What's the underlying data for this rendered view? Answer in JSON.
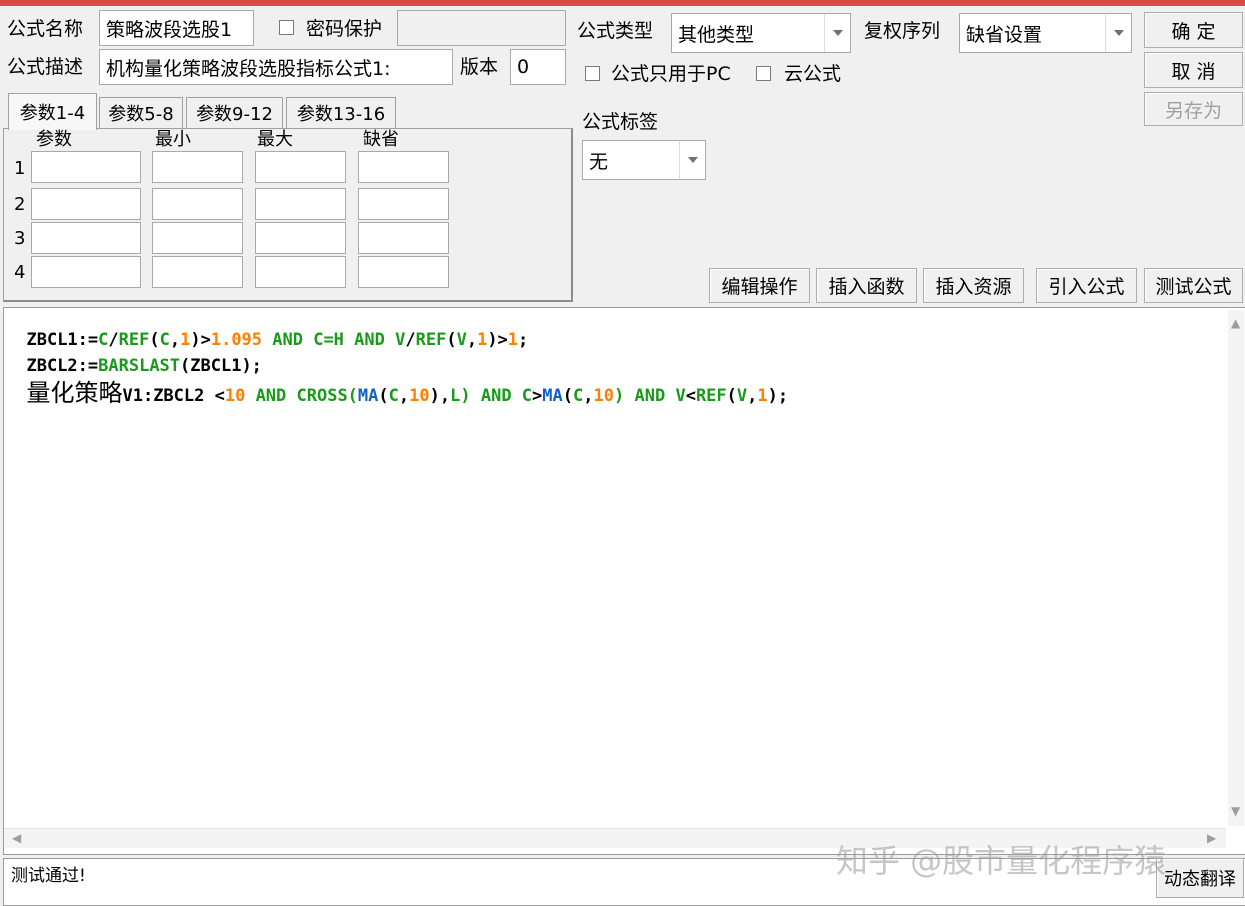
{
  "name_label": "公式名称",
  "name_value": "策略波段选股1",
  "password_label": "密码保护",
  "desc_label": "公式描述",
  "desc_value": "机构量化策略波段选股指标公式1:",
  "version_label": "版本",
  "version_value": "0",
  "type_label": "公式类型",
  "type_value": "其他类型",
  "rights_label": "复权序列",
  "rights_value": "缺省设置",
  "pc_only_label": "公式只用于PC",
  "cloud_label": "云公式",
  "tag_label": "公式标签",
  "tag_value": "无",
  "buttons": {
    "ok": "确 定",
    "cancel": "取 消",
    "save_as": "另存为",
    "edit": "编辑操作",
    "insert_func": "插入函数",
    "insert_res": "插入资源",
    "import": "引入公式",
    "test": "测试公式",
    "dynamic": "动态翻译"
  },
  "tabs": [
    "参数1-4",
    "参数5-8",
    "参数9-12",
    "参数13-16"
  ],
  "param_headers": [
    "参数",
    "最小",
    "最大",
    "缺省"
  ],
  "param_rows": [
    "1",
    "2",
    "3",
    "4"
  ],
  "code": {
    "l1": [
      "ZBCL1:=",
      "C",
      "/",
      "REF",
      "(",
      "C",
      ",",
      "1",
      ")>",
      "1.095",
      " AND C=H AND ",
      "V",
      "/",
      "REF",
      "(",
      "V",
      ",",
      "1",
      ")>",
      "1",
      ";"
    ],
    "l2": [
      "ZBCL2:=",
      "BARSLAST",
      "(ZBCL1);"
    ],
    "l3_cjk": "量化策略",
    "l3": [
      "V1:ZBCL2 <",
      "10",
      " AND CROSS(",
      "MA",
      "(",
      "C",
      ",",
      "10",
      "),",
      "L",
      ") AND ",
      "C",
      ">",
      "MA",
      "(",
      "C",
      ",",
      "10",
      ") AND ",
      "V",
      "<",
      "REF",
      "(",
      "V",
      ",",
      "1",
      ");"
    ]
  },
  "status_text": "测试通过!",
  "watermark": "知乎 @股市量化程序猿",
  "colors": {
    "function": "#1a9a1a",
    "number": "#ff7f00",
    "builtin": "#1560c4",
    "accent": "#d94a4a"
  }
}
